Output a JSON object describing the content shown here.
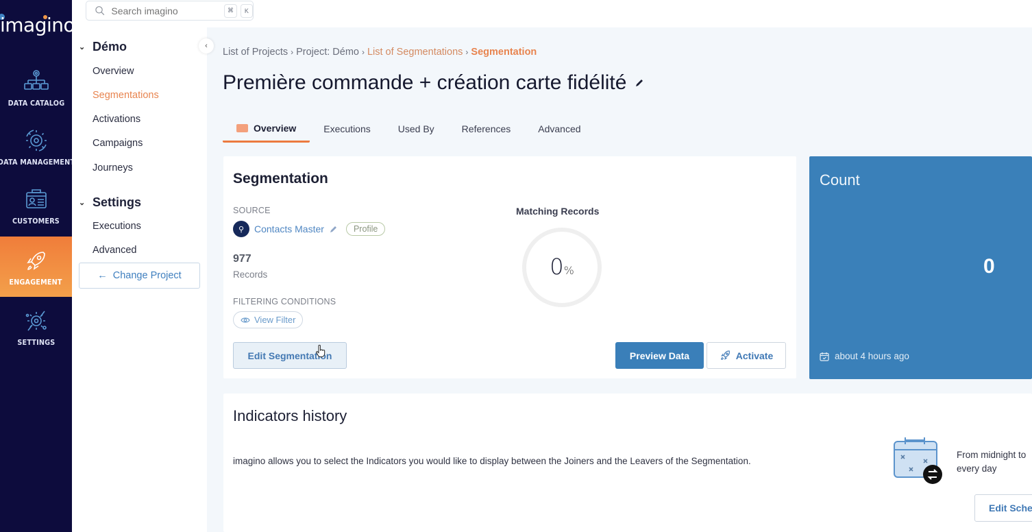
{
  "brand": {
    "name": "imagino"
  },
  "search": {
    "placeholder": "Search imagino",
    "shortcut_keys": [
      "⌘",
      "K"
    ]
  },
  "rail": {
    "items": [
      {
        "label": "DATA CATALOG",
        "icon": "data-catalog-icon",
        "active": false
      },
      {
        "label": "DATA MANAGEMENT",
        "icon": "data-management-icon",
        "active": false
      },
      {
        "label": "CUSTOMERS",
        "icon": "customers-icon",
        "active": false
      },
      {
        "label": "ENGAGEMENT",
        "icon": "rocket-icon",
        "active": true
      },
      {
        "label": "SETTINGS",
        "icon": "settings-icon",
        "active": false
      }
    ]
  },
  "subnav": {
    "groups": [
      {
        "title": "Démo",
        "items": [
          {
            "label": "Overview",
            "active": false
          },
          {
            "label": "Segmentations",
            "active": true
          },
          {
            "label": "Activations",
            "active": false
          },
          {
            "label": "Campaigns",
            "active": false
          },
          {
            "label": "Journeys",
            "active": false
          }
        ]
      },
      {
        "title": "Settings",
        "items": [
          {
            "label": "Executions",
            "active": false
          },
          {
            "label": "Advanced",
            "active": false
          }
        ]
      }
    ],
    "change_project": "Change Project",
    "collapse_glyph": "‹"
  },
  "breadcrumb": [
    {
      "label": "List of Projects"
    },
    {
      "label": "Project: Démo"
    },
    {
      "label": "List of Segmentations"
    },
    {
      "label": "Segmentation"
    }
  ],
  "page": {
    "title": "Première commande + création carte fidélité"
  },
  "tabs": [
    {
      "label": "Overview",
      "active": true
    },
    {
      "label": "Executions",
      "active": false
    },
    {
      "label": "Used By",
      "active": false
    },
    {
      "label": "References",
      "active": false
    },
    {
      "label": "Advanced",
      "active": false
    }
  ],
  "segmentation": {
    "title": "Segmentation",
    "source_label": "SOURCE",
    "source_name": "Contacts Master",
    "source_badge": "Profile",
    "records_count": "977",
    "records_label": "Records",
    "filtering_label": "FILTERING CONDITIONS",
    "view_filter": "View Filter",
    "matching_title": "Matching Records",
    "matching_percent": 0,
    "matching_value": "0",
    "percent_sign": "%",
    "edit_button": "Edit Segmentation",
    "preview_button": "Preview Data",
    "activate_button": "Activate"
  },
  "count": {
    "title": "Count",
    "value": "0",
    "updated": "about 4 hours ago"
  },
  "indicators": {
    "title": "Indicators history",
    "description": "imagino allows you to select the Indicators you would like to display between the Joiners and the Leavers of the Segmentation.",
    "schedule_line1": "From midnight to",
    "schedule_line2": "every day",
    "edit_schedule_button": "Edit Sche"
  },
  "colors": {
    "rail_bg": "#0d0c3d",
    "accent_orange": "#ec7a3f",
    "primary_blue": "#3a80b9",
    "link_blue": "#4f86c2"
  }
}
